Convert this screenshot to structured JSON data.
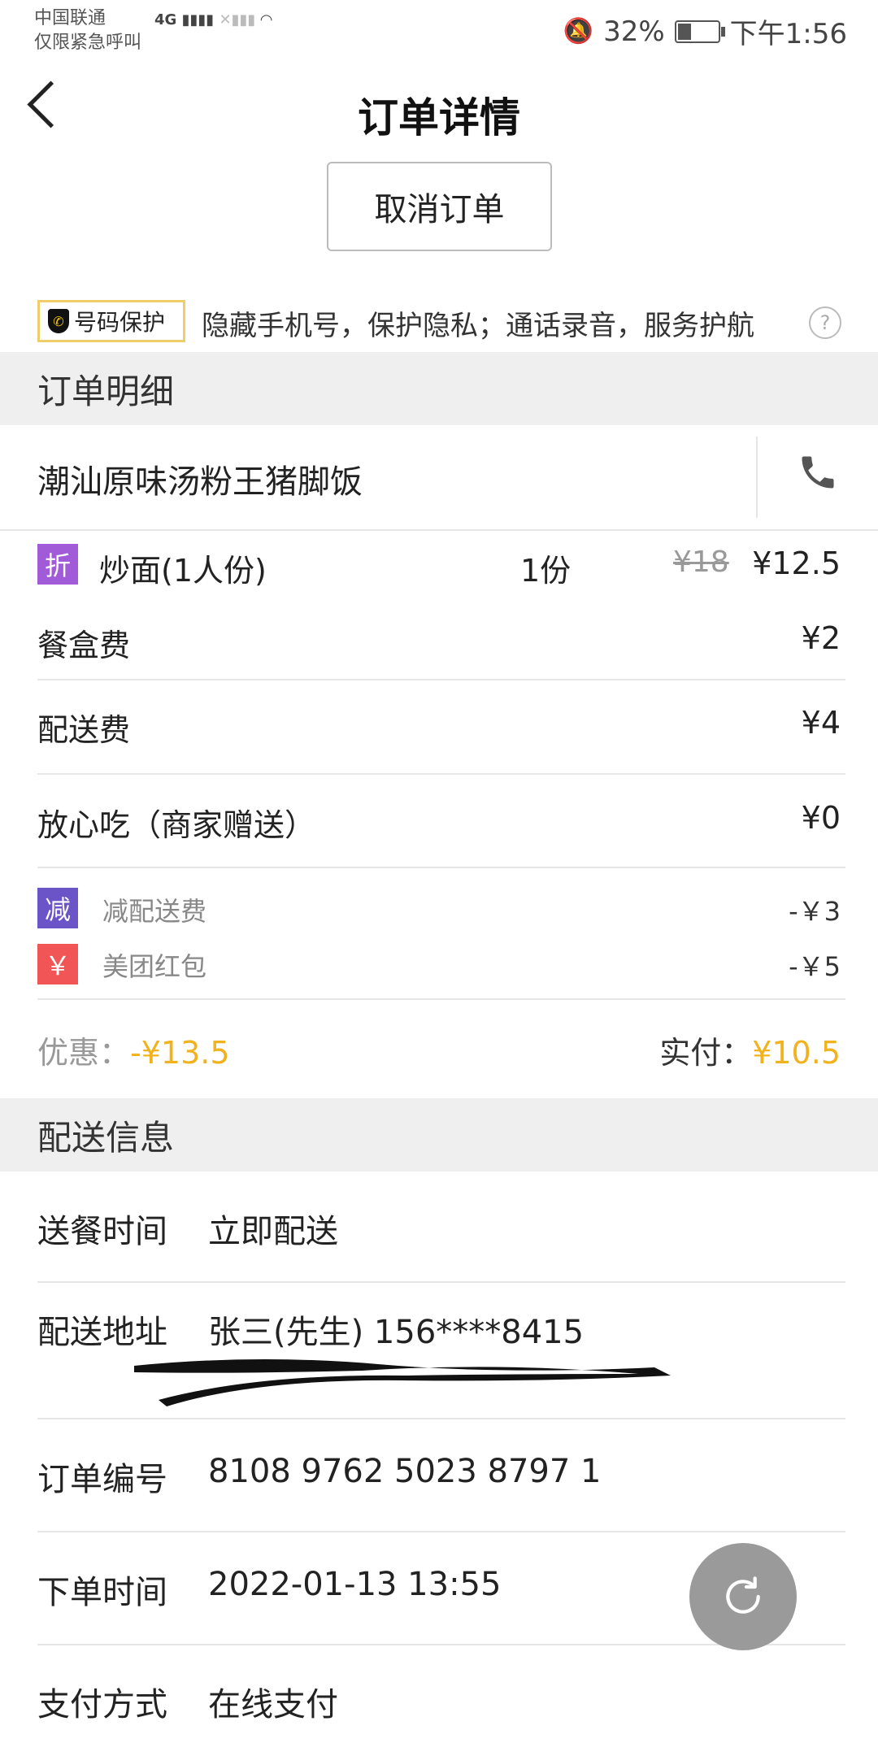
{
  "status_bar": {
    "carrier": "中国联通",
    "carrier_note": "仅限紧急呼叫",
    "network": "4G",
    "battery": "32%",
    "time": "下午1:56"
  },
  "header": {
    "title": "订单详情",
    "cancel_label": "取消订单"
  },
  "protect": {
    "badge": "号码保护",
    "text": "隐藏手机号，保护隐私；通话录音，服务护航",
    "help": "?"
  },
  "order_detail": {
    "heading": "订单明细",
    "shop_name": "潮汕原味汤粉王猪脚饭",
    "item": {
      "tag": "折",
      "name": "炒面(1人份)",
      "qty": "1份",
      "orig_price": "¥18",
      "price": "¥12.5"
    },
    "fees": [
      {
        "label": "餐盒费",
        "value": "¥2"
      },
      {
        "label": "配送费",
        "value": "¥4"
      },
      {
        "label": "放心吃（商家赠送）",
        "value": "¥0"
      }
    ],
    "discounts": [
      {
        "tag": "减",
        "label": "减配送费",
        "value": "-￥3"
      },
      {
        "tag": "￥",
        "label": "美团红包",
        "value": "-￥5"
      }
    ],
    "summary": {
      "discount_label": "优惠：",
      "discount_value": "-¥13.5",
      "paid_label": "实付：",
      "paid_value": "¥10.5"
    }
  },
  "delivery": {
    "heading": "配送信息",
    "rows": [
      {
        "label": "送餐时间",
        "value": "立即配送"
      },
      {
        "label": "配送地址",
        "value": "张三(先生) 156****8415"
      },
      {
        "label": "订单编号",
        "value": "8108 9762 5023 8797 1"
      },
      {
        "label": "下单时间",
        "value": "2022-01-13 13:55"
      },
      {
        "label": "支付方式",
        "value": "在线支付"
      }
    ]
  },
  "colors": {
    "accent": "#f1b21e",
    "tag_discount": "#a15ad8",
    "tag_reduce": "#6a54c8",
    "tag_redpacket": "#f25555"
  }
}
